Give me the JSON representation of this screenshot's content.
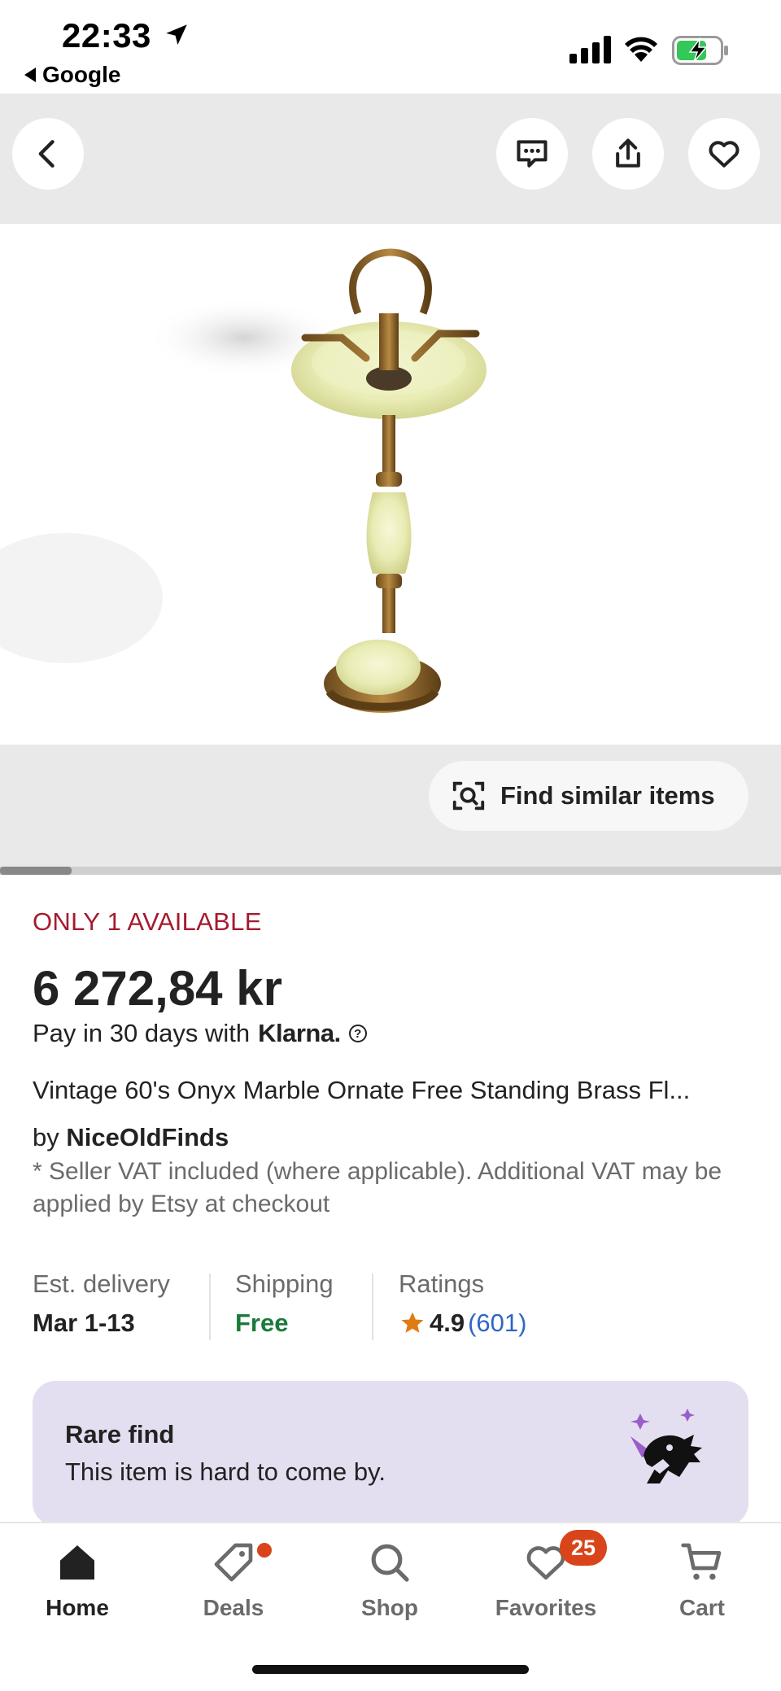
{
  "status_bar": {
    "time": "22:33",
    "back_app": "Google"
  },
  "colors": {
    "availability": "#a61a2e",
    "free_shipping": "#1b7a3a",
    "rating_link": "#2f66c4",
    "star": "#e07b14",
    "rare_card_bg": "#e4dff0",
    "badge": "#d9441a"
  },
  "top_nav": {
    "icons": [
      "back-chevron-icon",
      "message-icon",
      "share-icon",
      "heart-icon"
    ]
  },
  "image_carousel": {
    "find_similar_label": "Find similar items",
    "position": "1"
  },
  "product": {
    "availability": "ONLY 1 AVAILABLE",
    "price": "6 272,84 kr",
    "klarna_text": "Pay in 30 days with",
    "klarna_brand": "Klarna.",
    "title": "Vintage 60's Onyx Marble Ornate Free Standing Brass Fl...",
    "by": "by",
    "shop_name": "NiceOldFinds",
    "vat_note": "* Seller VAT included (where applicable). Additional VAT may be applied by Etsy at checkout"
  },
  "stats": {
    "delivery_label": "Est. delivery",
    "delivery_value": "Mar 1-13",
    "shipping_label": "Shipping",
    "shipping_value": "Free",
    "ratings_label": "Ratings",
    "rating_value": "4.9",
    "rating_count": "(601)"
  },
  "rare_find": {
    "title": "Rare find",
    "subtitle": "This item is hard to come by."
  },
  "tab_bar": {
    "items": [
      {
        "label": "Home",
        "icon": "home-icon"
      },
      {
        "label": "Deals",
        "icon": "tag-icon"
      },
      {
        "label": "Shop",
        "icon": "search-icon"
      },
      {
        "label": "Favorites",
        "icon": "heart-icon",
        "badge": "25"
      },
      {
        "label": "Cart",
        "icon": "cart-icon"
      }
    ]
  }
}
